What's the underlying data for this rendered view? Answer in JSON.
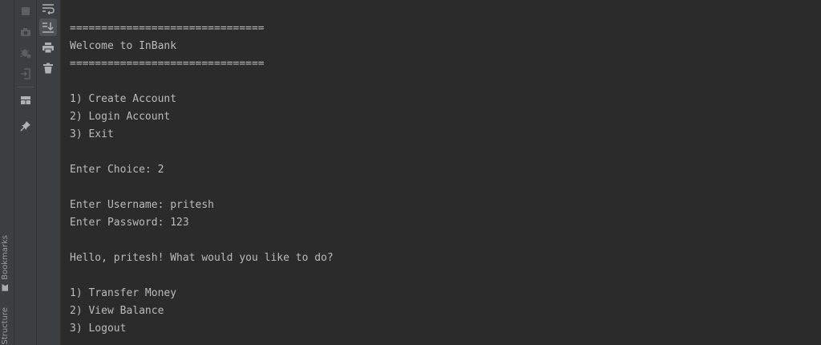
{
  "side_tabs": {
    "bookmarks": "Bookmarks",
    "structure": "Structure"
  },
  "left_toolbar": [
    {
      "icon": "stop-icon",
      "enabled": false
    },
    {
      "icon": "camera-icon",
      "enabled": false
    },
    {
      "icon": "bug-settings-icon",
      "enabled": false
    },
    {
      "icon": "exit-icon",
      "enabled": false
    },
    {
      "icon": "layout-icon",
      "enabled": true
    },
    {
      "icon": "pin-icon",
      "enabled": true
    }
  ],
  "console_toolbar": [
    {
      "icon": "soft-wrap-icon",
      "active": false
    },
    {
      "icon": "scroll-to-end-icon",
      "active": true
    },
    {
      "icon": "print-icon",
      "active": false
    },
    {
      "icon": "trash-icon",
      "active": false
    }
  ],
  "colors": {
    "background": "#2b2b2b",
    "panel": "#3c3f41",
    "text": "#bbbbbb",
    "icon": "#afb1b3"
  },
  "console": {
    "lines": [
      "===============================",
      "Welcome to InBank",
      "===============================",
      "",
      "1) Create Account",
      "2) Login Account",
      "3) Exit",
      "",
      "Enter Choice: 2",
      "",
      "Enter Username: pritesh",
      "Enter Password: 123",
      "",
      "Hello, pritesh! What would you like to do?",
      "",
      "1) Transfer Money",
      "2) View Balance",
      "3) Logout"
    ]
  }
}
